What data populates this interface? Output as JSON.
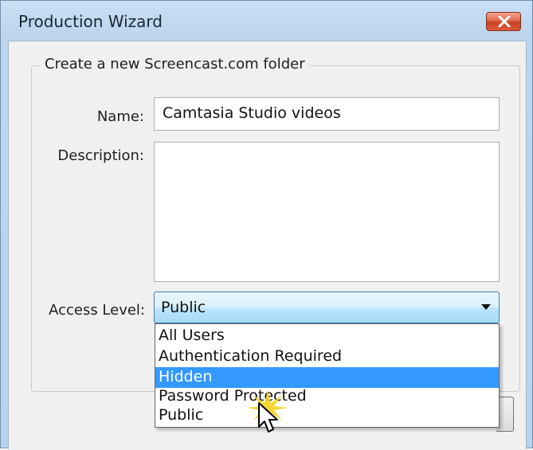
{
  "window": {
    "title": "Production Wizard"
  },
  "group": {
    "legend": "Create a new Screencast.com folder"
  },
  "form": {
    "name_label": "Name:",
    "name_value": "Camtasia Studio videos",
    "description_label": "Description:",
    "description_value": "",
    "access_label": "Access Level:",
    "access_value": "Public"
  },
  "dropdown": {
    "options": [
      "All Users",
      "Authentication Required",
      "Hidden",
      "Password Protected",
      "Public"
    ],
    "highlighted": "Hidden"
  },
  "colors": {
    "highlight": "#3399ff",
    "close_button": "#d85b3c",
    "titlebar": "#c9dff3"
  },
  "icons": {
    "close": "close-x-icon",
    "dropdown": "chevron-down-icon",
    "cursor": "mouse-pointer-icon",
    "click": "click-burst-icon"
  }
}
